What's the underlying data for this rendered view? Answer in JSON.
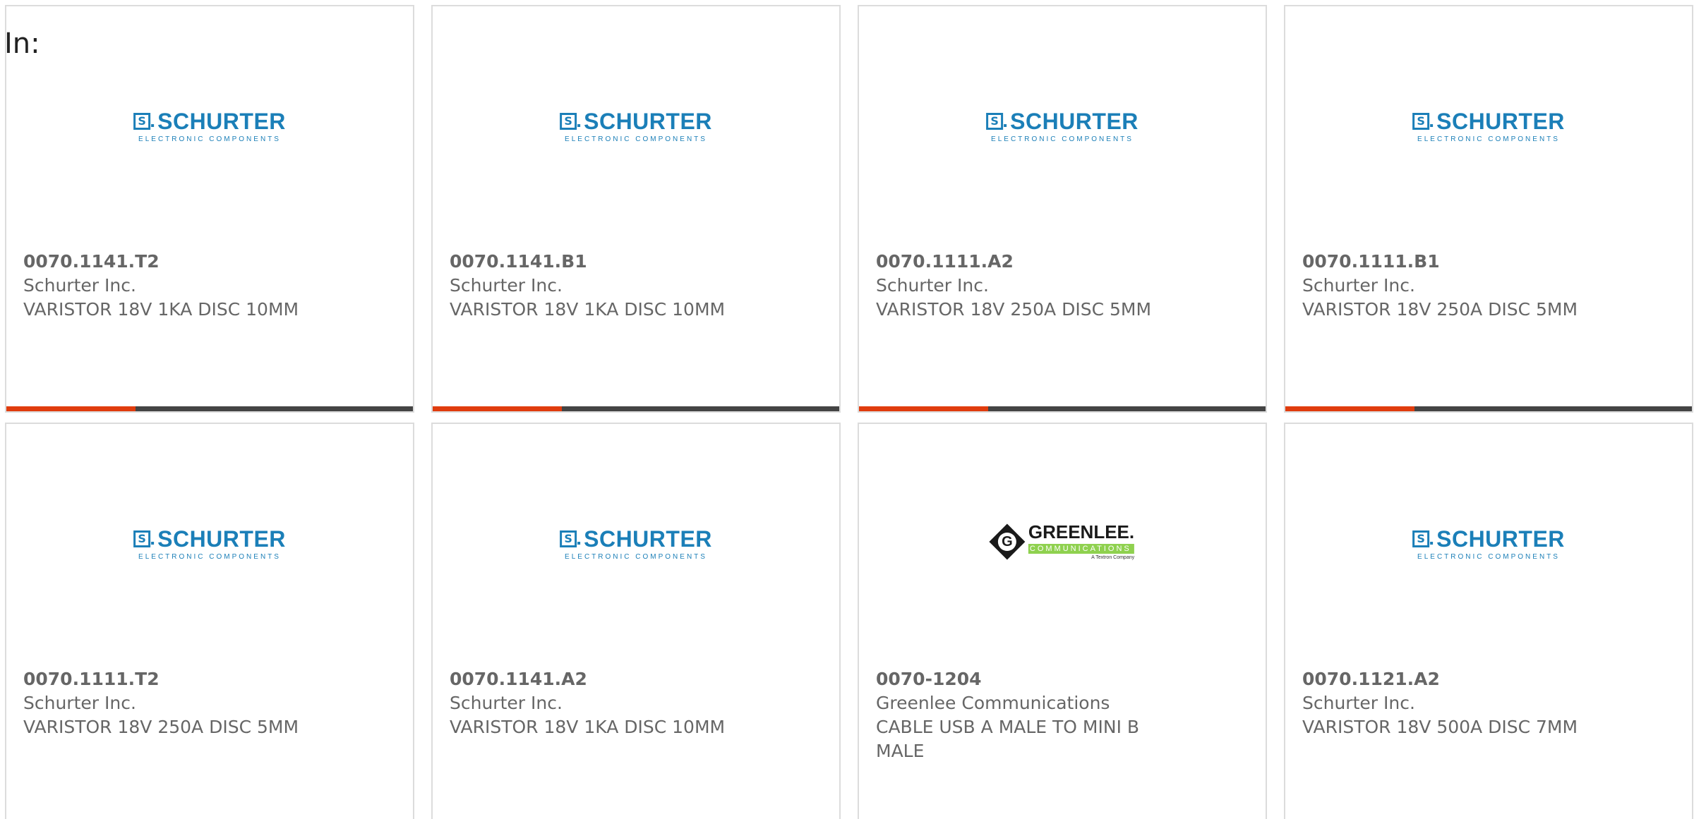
{
  "header": {
    "in_label": "In:"
  },
  "colors": {
    "accent_bar": "#e03c0e",
    "dark_bar": "#444444",
    "schurter_blue": "#1b7fb8",
    "greenlee_green": "#8fd14f",
    "text_gray": "#666666",
    "card_border": "#dcdcdc"
  },
  "logos": {
    "schurter": {
      "brand": "SCHURTER",
      "mark": "S",
      "tagline": "ELECTRONIC COMPONENTS"
    },
    "greenlee": {
      "brand": "GREENLEE.",
      "mark": "G",
      "sub": "COMMUNICATIONS",
      "sub2": "A Textron Company"
    }
  },
  "products": [
    {
      "logo": "schurter",
      "part": "0070.1141.T2",
      "manufacturer": "Schurter Inc.",
      "description": "VARISTOR 18V 1KA DISC 10MM"
    },
    {
      "logo": "schurter",
      "part": "0070.1141.B1",
      "manufacturer": "Schurter Inc.",
      "description": "VARISTOR 18V 1KA DISC 10MM"
    },
    {
      "logo": "schurter",
      "part": "0070.1111.A2",
      "manufacturer": "Schurter Inc.",
      "description": "VARISTOR 18V 250A DISC 5MM"
    },
    {
      "logo": "schurter",
      "part": "0070.1111.B1",
      "manufacturer": "Schurter Inc.",
      "description": "VARISTOR 18V 250A DISC 5MM"
    },
    {
      "logo": "schurter",
      "part": "0070.1111.T2",
      "manufacturer": "Schurter Inc.",
      "description": "VARISTOR 18V 250A DISC 5MM"
    },
    {
      "logo": "schurter",
      "part": "0070.1141.A2",
      "manufacturer": "Schurter Inc.",
      "description": "VARISTOR 18V 1KA DISC 10MM"
    },
    {
      "logo": "greenlee",
      "part": "0070-1204",
      "manufacturer": "Greenlee Communications",
      "description": "CABLE USB A MALE TO MINI B MALE"
    },
    {
      "logo": "schurter",
      "part": "0070.1121.A2",
      "manufacturer": "Schurter Inc.",
      "description": "VARISTOR 18V 500A DISC 7MM"
    }
  ]
}
